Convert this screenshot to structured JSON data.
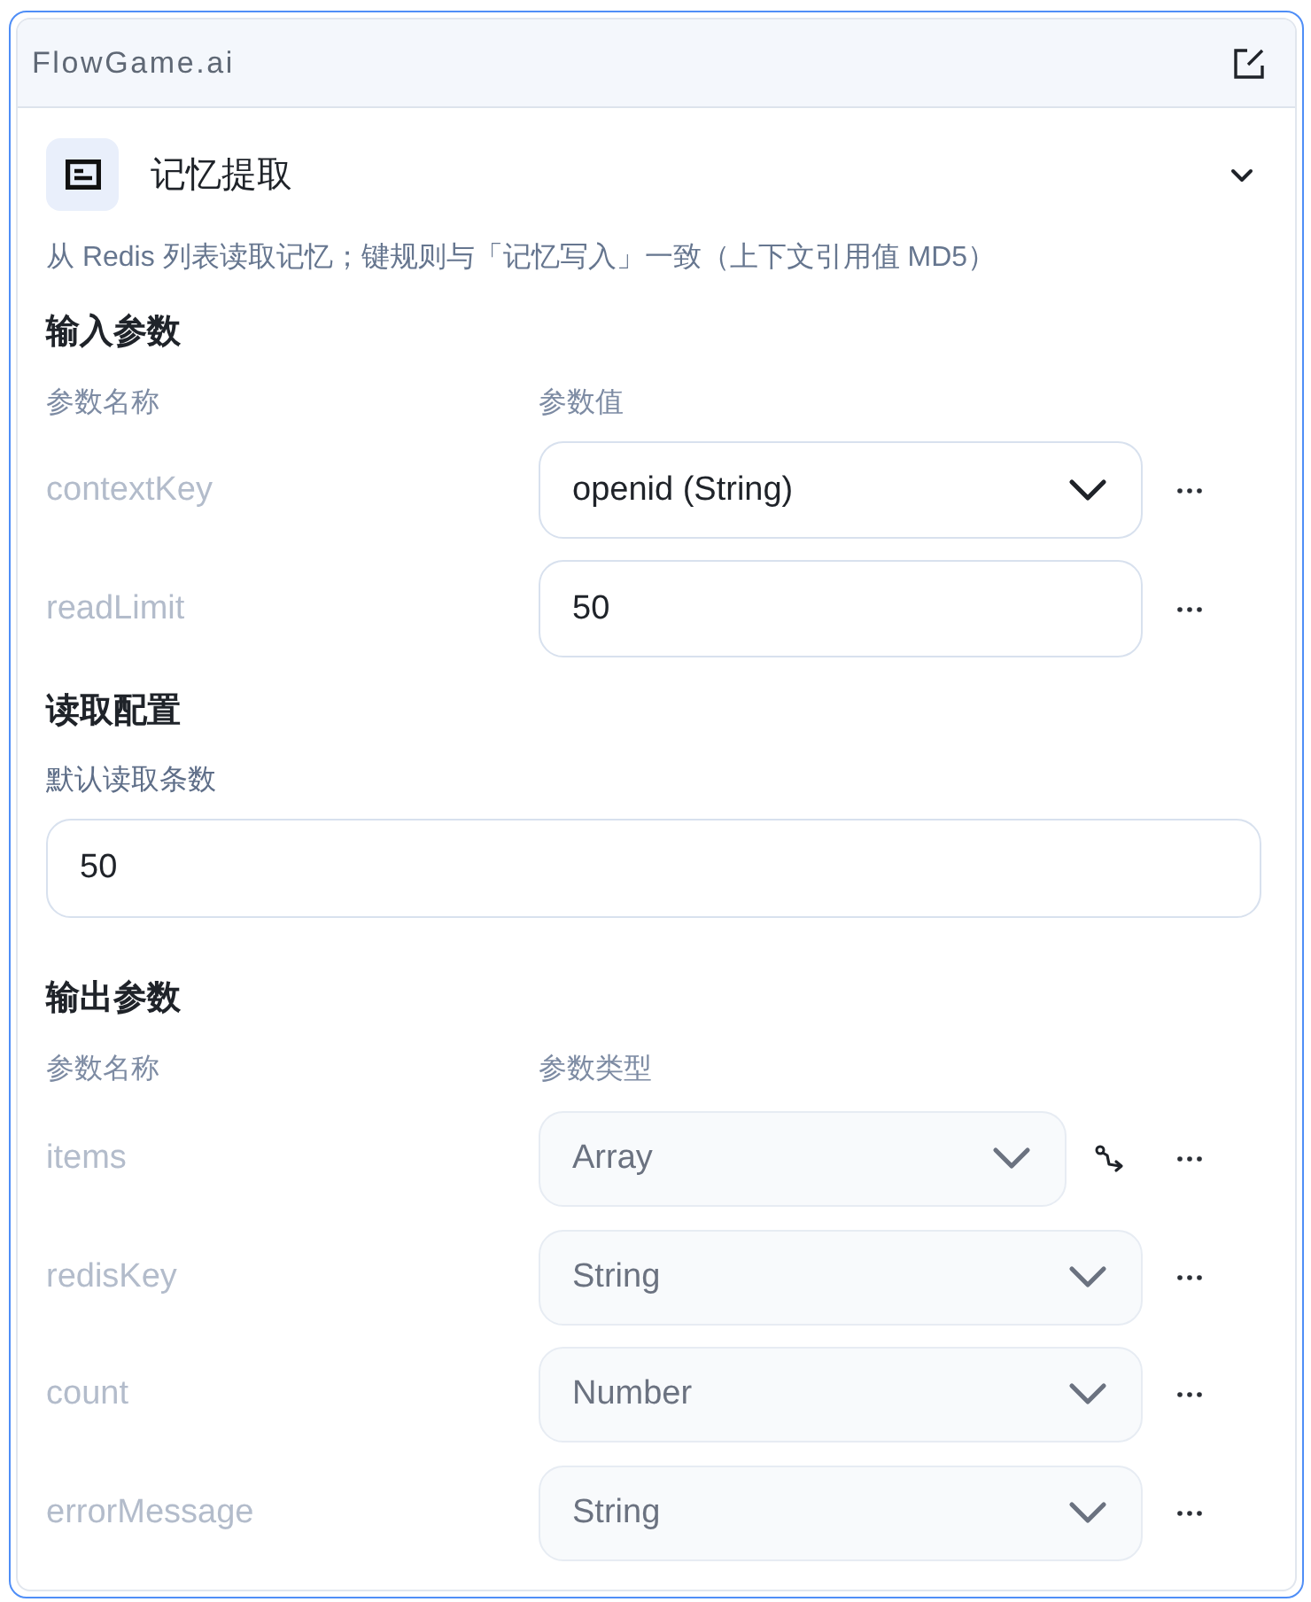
{
  "app": {
    "title": "FlowGame.ai"
  },
  "node": {
    "title": "记忆提取",
    "expanded": true,
    "description": "从 Redis 列表读取记忆；键规则与「记忆写入」一致（上下文引用值 MD5）"
  },
  "input_params": {
    "heading": "输入参数",
    "columns": [
      "参数名称",
      "参数值"
    ],
    "rows": [
      {
        "name": "contextKey",
        "kind": "select",
        "value": "openid (String)"
      },
      {
        "name": "readLimit",
        "kind": "text",
        "value": "50"
      }
    ]
  },
  "read_config": {
    "heading": "读取配置",
    "fields": [
      {
        "label": "默认读取条数",
        "value": "50"
      }
    ]
  },
  "output_params": {
    "heading": "输出参数",
    "columns": [
      "参数名称",
      "参数类型"
    ],
    "rows": [
      {
        "name": "items",
        "type": "Array",
        "kind": "nested",
        "disabled": true
      },
      {
        "name": "redisKey",
        "type": "String",
        "kind": "plain",
        "disabled": true
      },
      {
        "name": "count",
        "type": "Number",
        "kind": "plain",
        "disabled": true
      },
      {
        "name": "errorMessage",
        "type": "String",
        "kind": "plain",
        "disabled": true
      }
    ]
  }
}
